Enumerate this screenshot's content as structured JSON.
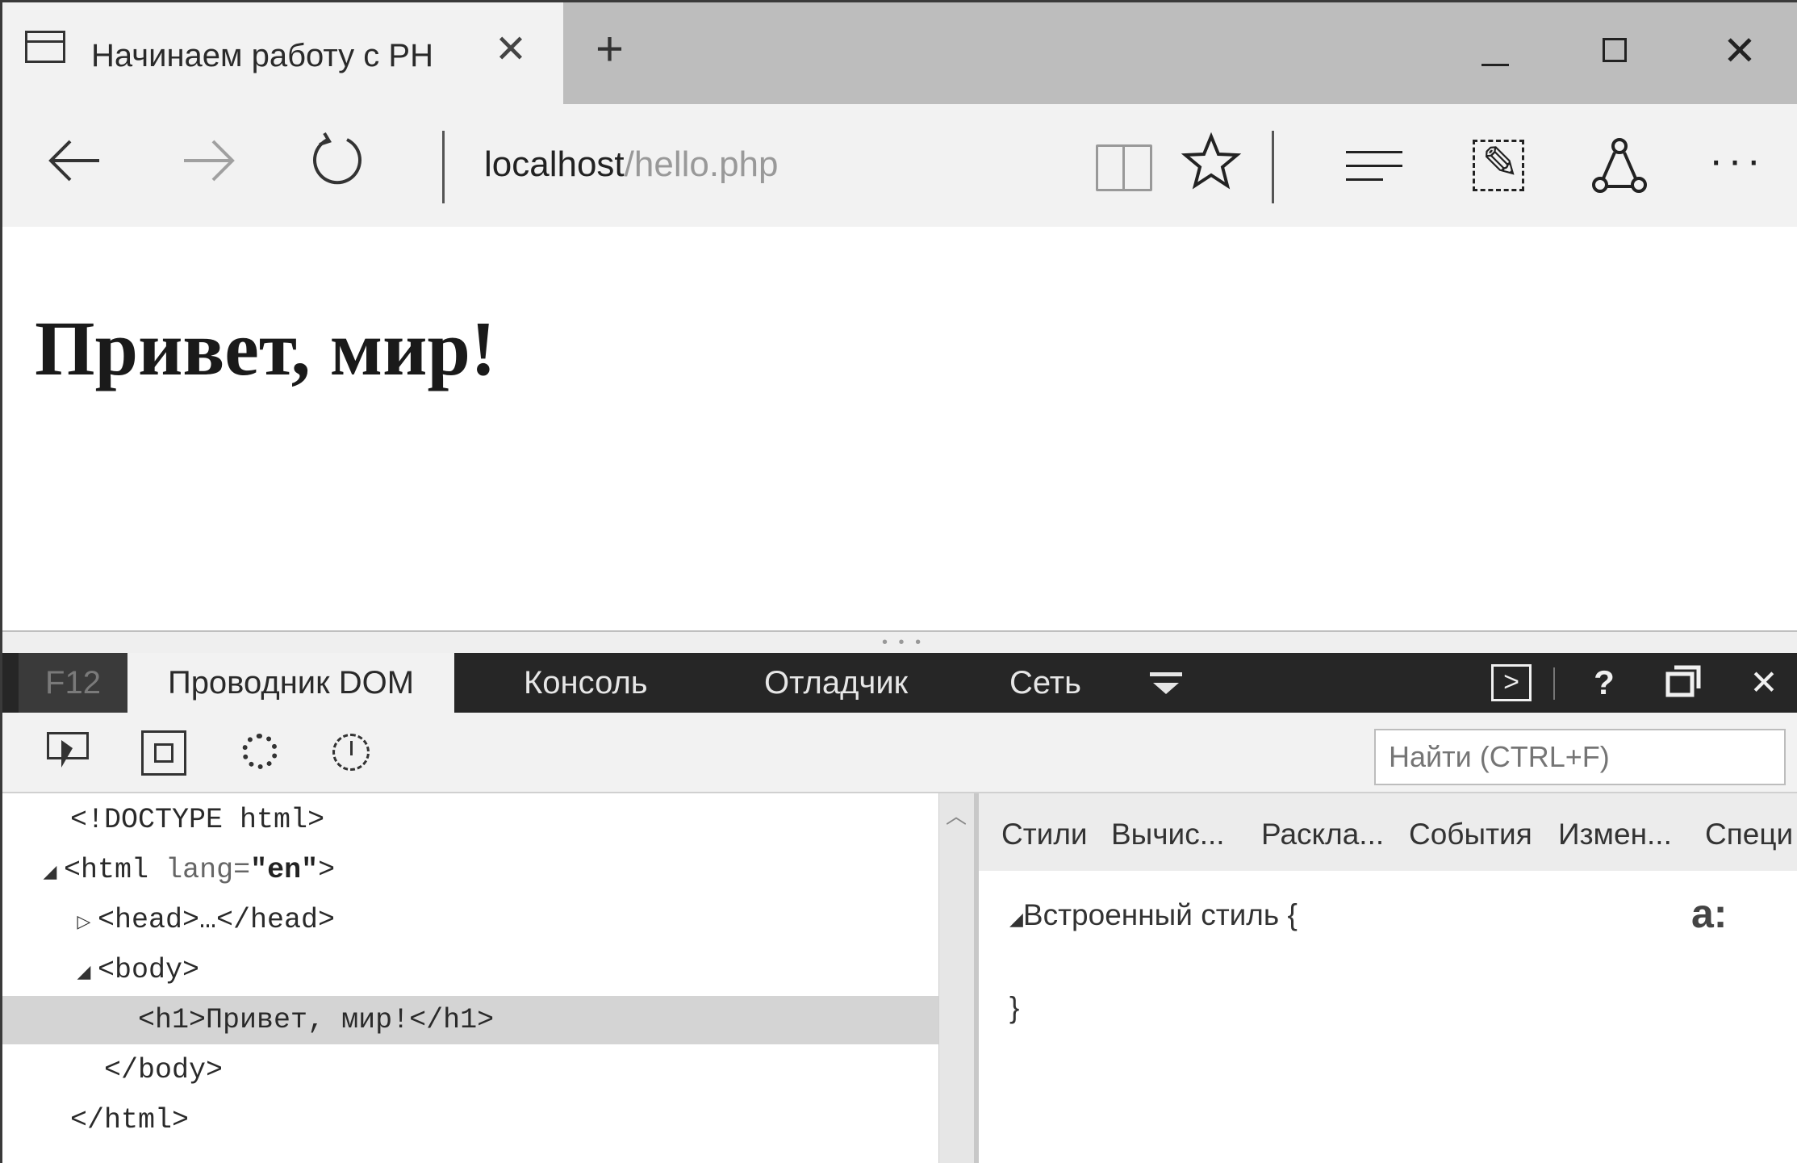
{
  "browser": {
    "tab_title": "Начинаем работу с PH",
    "tab_close_glyph": "✕",
    "new_tab_glyph": "+",
    "window_close_glyph": "✕",
    "url_host": "localhost",
    "url_path": "/hello.php",
    "icons": [
      "page-icon",
      "back-arrow-icon",
      "forward-arrow-icon",
      "refresh-icon",
      "reading-view-icon",
      "star-icon",
      "hub-icon",
      "web-note-icon",
      "share-icon",
      "more-icon"
    ]
  },
  "page": {
    "heading": "Привет, мир!"
  },
  "devtools": {
    "f12_label": "F12",
    "tabs": [
      "Проводник DOM",
      "Консоль",
      "Отладчик",
      "Сеть"
    ],
    "find_placeholder": "Найти (CTRL+F)",
    "dom_tree": {
      "doctype": "<!DOCTYPE html>",
      "html_open_tag": "<html",
      "html_attr_name": "lang=",
      "html_attr_value": "\"en\"",
      "html_open_end": ">",
      "head_collapsed": "<head>…</head>",
      "body_open": "<body>",
      "h1_line": "<h1>Привет, мир!</h1>",
      "body_close": "</body>",
      "html_close": "</html>"
    },
    "styles_tabs": [
      "Стили",
      "Вычис...",
      "Раскла...",
      "События",
      "Измен...",
      "Специ"
    ],
    "inline_style_label": "Встроенный стиль  {",
    "inline_style_close": "}",
    "pseudo_button": "a:"
  },
  "colors": {
    "titlebar": "#bdbdbd",
    "tab_active": "#f2f2f2",
    "devtools_bar": "#262626",
    "selected_row": "#d4d4d4"
  }
}
